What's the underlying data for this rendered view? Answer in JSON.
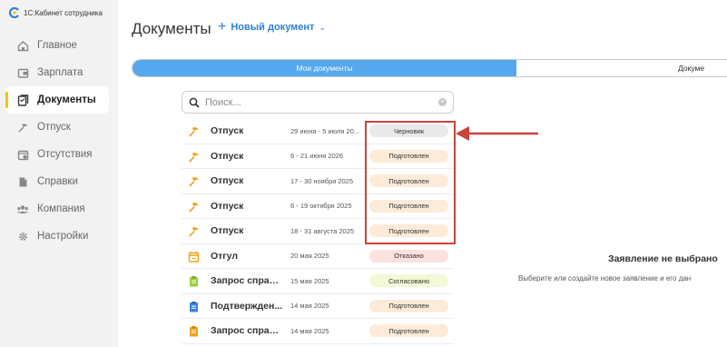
{
  "app": {
    "title": "1С:Кабинет сотрудника"
  },
  "sidebar": {
    "items": [
      {
        "label": "Главное",
        "icon": "home-icon"
      },
      {
        "label": "Зарплата",
        "icon": "wallet-icon"
      },
      {
        "label": "Документы",
        "icon": "documents-icon",
        "active": true
      },
      {
        "label": "Отпуск",
        "icon": "vacation-icon"
      },
      {
        "label": "Отсутствия",
        "icon": "absence-calendar-icon"
      },
      {
        "label": "Справки",
        "icon": "certificate-icon"
      },
      {
        "label": "Компания",
        "icon": "company-people-icon"
      },
      {
        "label": "Настройки",
        "icon": "gear-icon"
      }
    ]
  },
  "header": {
    "title": "Документы",
    "new_document_label": "Новый документ"
  },
  "tabs": [
    {
      "label": "Мои документы",
      "active": true
    },
    {
      "label": "Докуме"
    }
  ],
  "search": {
    "placeholder": "Поиск...",
    "value": ""
  },
  "documents": [
    {
      "name": "Отпуск",
      "date": "29 июня - 5 июля 20...",
      "status": "Черновик",
      "status_color": "#e9e9e9",
      "icon": "vacation-icon"
    },
    {
      "name": "Отпуск",
      "date": "6 - 21 июня 2026",
      "status": "Подготовлен",
      "status_color": "#fdebd8",
      "icon": "vacation-icon"
    },
    {
      "name": "Отпуск",
      "date": "17 - 30 ноября 2025",
      "status": "Подготовлен",
      "status_color": "#fdebd8",
      "icon": "vacation-icon"
    },
    {
      "name": "Отпуск",
      "date": "6 - 19 октября 2025",
      "status": "Подготовлен",
      "status_color": "#fdebd8",
      "icon": "vacation-icon"
    },
    {
      "name": "Отпуск",
      "date": "18 - 31 августа 2025",
      "status": "Подготовлен",
      "status_color": "#fdebd8",
      "icon": "vacation-icon"
    },
    {
      "name": "Отгул",
      "date": "20 мая 2025",
      "status": "Отказано",
      "status_color": "#fde0e0",
      "icon": "calendar-icon"
    },
    {
      "name": "Запрос справк...",
      "date": "15 мая 2025",
      "status": "Согласовано",
      "status_color": "#f3f8d6",
      "icon": "clipboard-green-icon"
    },
    {
      "name": "Подтвержден...",
      "date": "14 мая 2025",
      "status": "Подготовлен",
      "status_color": "#fdebd8",
      "icon": "clipboard-blue-icon"
    },
    {
      "name": "Запрос справк...",
      "date": "14 мая 2025",
      "status": "Подготовлен",
      "status_color": "#fdebd8",
      "icon": "clipboard-orange-icon"
    }
  ],
  "empty_state": {
    "title": "Заявление не выбрано",
    "subtitle": "Выберите или создайте новое заявление и его дан"
  },
  "colors": {
    "accent_blue": "#2b7fd7",
    "tab_active": "#55a7ee",
    "active_marker": "#f5c400",
    "annotation_red": "#c9443c"
  }
}
